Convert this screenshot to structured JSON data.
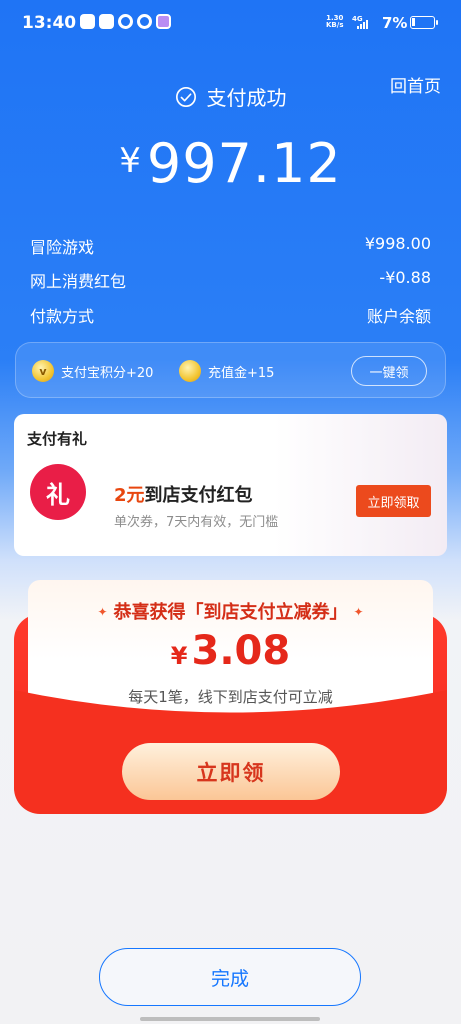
{
  "status_bar": {
    "time": "13:40",
    "net_speed_top": "1.30",
    "net_speed_bottom": "KB/s",
    "net_type": "4G",
    "battery": "7%"
  },
  "header": {
    "home_link": "回首页",
    "success_text": "支付成功",
    "currency_symbol": "¥",
    "amount": "997.12"
  },
  "details": [
    {
      "label": "冒险游戏",
      "value": "¥998.00"
    },
    {
      "label": "网上消费红包",
      "value": "-¥0.88"
    },
    {
      "label": "付款方式",
      "value": "账户余额"
    }
  ],
  "points": {
    "alipay_points": "支付宝积分+20",
    "recharge_gold": "充值金+15",
    "claim_all": "一键领"
  },
  "gift": {
    "section_title": "支付有礼",
    "icon_char": "礼",
    "name_highlight": "2元",
    "name_rest": "到店支付红包",
    "desc": "单次券，7天内有效，无门槛",
    "button": "立即领取"
  },
  "coupon": {
    "title": "恭喜获得「到店支付立减券」",
    "currency_symbol": "¥",
    "amount": "3.08",
    "subtitle": "每天1笔，线下到店支付可立减",
    "button": "立即领"
  },
  "footer": {
    "done": "完成"
  },
  "colors": {
    "primary_blue": "#1f74f5",
    "coupon_red": "#f3271c",
    "gift_red": "#e91e47",
    "button_orange": "#ec4a1d"
  }
}
